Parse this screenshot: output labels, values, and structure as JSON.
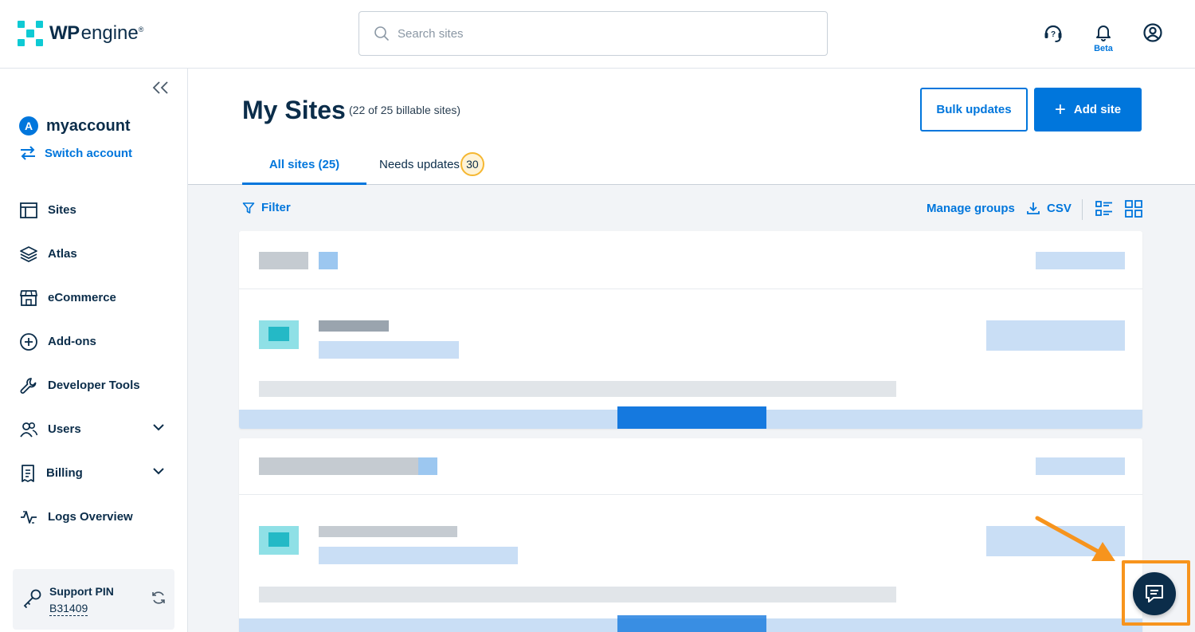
{
  "brand": {
    "wp": "WP",
    "engine": "engine",
    "reg": "®"
  },
  "search": {
    "placeholder": "Search sites"
  },
  "header": {
    "beta": "Beta"
  },
  "sidebar": {
    "account_initial": "A",
    "account_name": "myaccount",
    "switch_label": "Switch account",
    "items": [
      {
        "label": "Sites",
        "icon": "sites-icon"
      },
      {
        "label": "Atlas",
        "icon": "layers-icon"
      },
      {
        "label": "eCommerce",
        "icon": "store-icon"
      },
      {
        "label": "Add-ons",
        "icon": "plus-circle-icon"
      },
      {
        "label": "Developer Tools",
        "icon": "wrench-icon"
      },
      {
        "label": "Users",
        "icon": "users-icon"
      },
      {
        "label": "Billing",
        "icon": "receipt-icon"
      },
      {
        "label": "Logs Overview",
        "icon": "logs-icon"
      }
    ],
    "support": {
      "title": "Support PIN",
      "pin": "B31409"
    }
  },
  "main": {
    "title": "My Sites",
    "subtitle": "(22 of 25 billable sites)",
    "bulk_label": "Bulk updates",
    "add_label": "Add site",
    "tabs": [
      {
        "label": "All sites (25)"
      },
      {
        "label": "Needs updates",
        "badge": "30"
      }
    ],
    "filter_label": "Filter",
    "manage_label": "Manage groups",
    "csv_label": "CSV"
  },
  "colors": {
    "accent": "#0076dc",
    "navy": "#0b2d4a",
    "badge_ring": "#f5b731",
    "highlight": "#f7941d"
  }
}
